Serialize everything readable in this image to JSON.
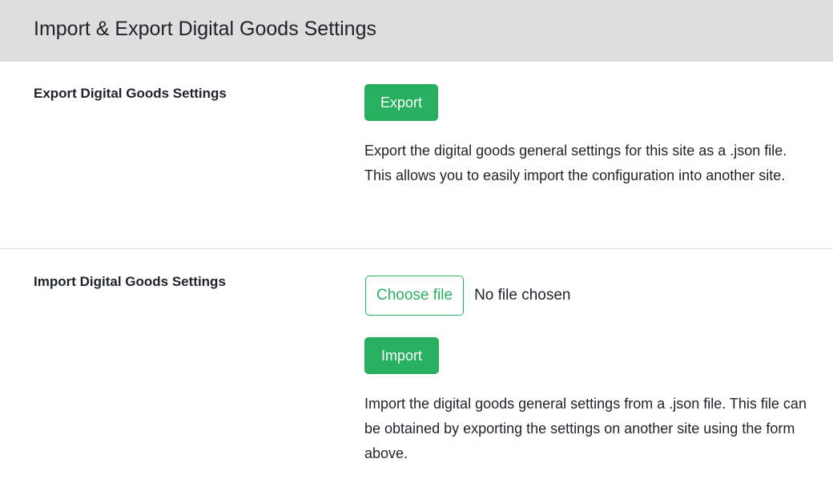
{
  "header": {
    "title": "Import & Export Digital Goods Settings"
  },
  "export_section": {
    "label": "Export Digital Goods Settings",
    "button_label": "Export",
    "description": "Export the digital goods general settings for this site as a .json file. This allows you to easily import the configuration into another site."
  },
  "import_section": {
    "label": "Import Digital Goods Settings",
    "file_button_label": "Choose file",
    "file_status": "No file chosen",
    "button_label": "Import",
    "description": "Import the digital goods general settings from a .json file. This file can be obtained by exporting the settings on another site using the form above."
  },
  "colors": {
    "accent": "#27b060",
    "header_bg": "#dedede",
    "divider": "#dcdcde"
  }
}
